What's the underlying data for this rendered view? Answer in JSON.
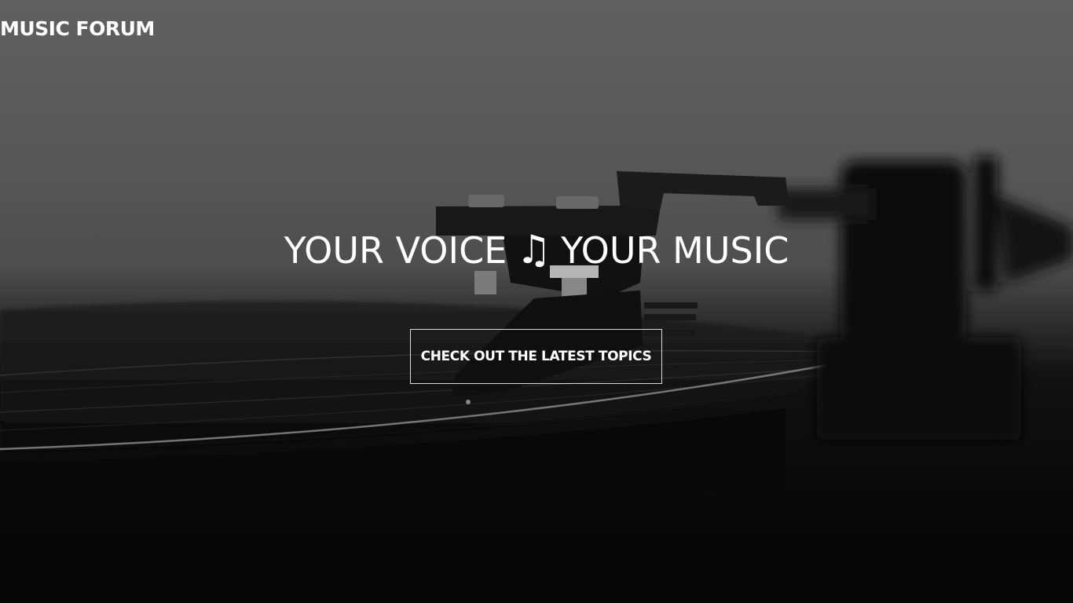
{
  "site": {
    "logo_text": "MUSIC FORUM"
  },
  "hero": {
    "tagline_left": "YOUR VOICE",
    "tagline_icon": "♫",
    "tagline_right": "YOUR MUSIC",
    "cta_label": "CHECK OUT THE LATEST TOPICS",
    "background_image": "vinyl-turntable-photo"
  },
  "colors": {
    "text": "#ffffff",
    "overlay": "#000000"
  }
}
